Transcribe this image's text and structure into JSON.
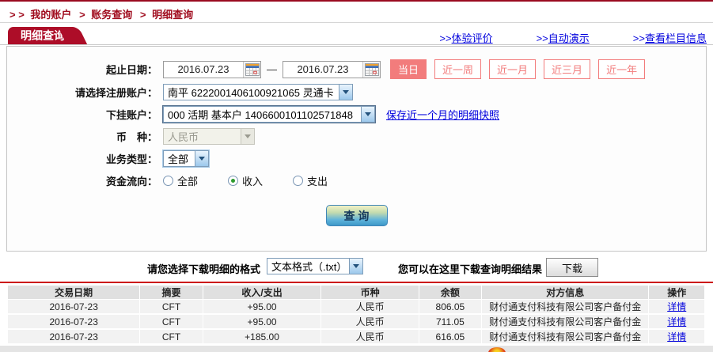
{
  "breadcrumb": {
    "prefix": "> >",
    "sep": ">",
    "items": [
      "我的账户",
      "账务查询",
      "明细查询"
    ]
  },
  "tab": {
    "title": "明细查询"
  },
  "header_links": [
    {
      "prefix": ">>",
      "label": "体验评价"
    },
    {
      "prefix": ">>",
      "label": "自动演示"
    },
    {
      "prefix": ">>",
      "label": "查看栏目信息"
    }
  ],
  "form": {
    "date_label": "起止日期：",
    "date_from": "2016.07.23",
    "date_to": "2016.07.23",
    "date_separator": "—",
    "quick_buttons": [
      {
        "label": "当日",
        "active": true
      },
      {
        "label": "近一周",
        "active": false
      },
      {
        "label": "近一月",
        "active": false
      },
      {
        "label": "近三月",
        "active": false
      },
      {
        "label": "近一年",
        "active": false
      }
    ],
    "register_account": {
      "label": "请选择注册账户：",
      "value": "南平  6222001406100921065  灵通卡"
    },
    "sub_account": {
      "label": "下挂账户：",
      "value": "000 活期 基本户  1406600101102571848"
    },
    "snapshot_link": "保存近一个月的明细快照",
    "currency": {
      "label": "币　种：",
      "value": "人民币",
      "disabled": true
    },
    "business_type": {
      "label": "业务类型：",
      "value": "全部"
    },
    "flow": {
      "label": "资金流向：",
      "options": [
        {
          "label": "全部",
          "checked": false
        },
        {
          "label": "收入",
          "checked": true
        },
        {
          "label": "支出",
          "checked": false
        }
      ]
    },
    "query_button": "查 询"
  },
  "download": {
    "format_label": "请您选择下载明细的格式",
    "format_value": "文本格式（.txt）",
    "hint": "您可以在这里下载查询明细结果",
    "button": "下载"
  },
  "table": {
    "headers": [
      "交易日期",
      "摘要",
      "收入/支出",
      "币种",
      "余额",
      "对方信息",
      "操作"
    ],
    "rows": [
      {
        "date": "2016-07-23",
        "summary": "CFT",
        "amount": "+95.00",
        "currency": "人民币",
        "balance": "806.05",
        "counterparty": "财付通支付科技有限公司客户备付金",
        "action": "详情"
      },
      {
        "date": "2016-07-23",
        "summary": "CFT",
        "amount": "+95.00",
        "currency": "人民币",
        "balance": "711.05",
        "counterparty": "财付通支付科技有限公司客户备付金",
        "action": "详情"
      },
      {
        "date": "2016-07-23",
        "summary": "CFT",
        "amount": "+185.00",
        "currency": "人民币",
        "balance": "616.05",
        "counterparty": "财付通支付科技有限公司客户备付金",
        "action": "详情"
      }
    ]
  },
  "colors": {
    "brand_red": "#ad0d28",
    "salmon_button": "#f27c7c",
    "link_blue": "#0000dd",
    "amount_red": "#d20000",
    "table_header_bg": "#e0e0e0",
    "table_row_bg": "#f2f2f2",
    "query_button_blue": "#3e98c8"
  }
}
